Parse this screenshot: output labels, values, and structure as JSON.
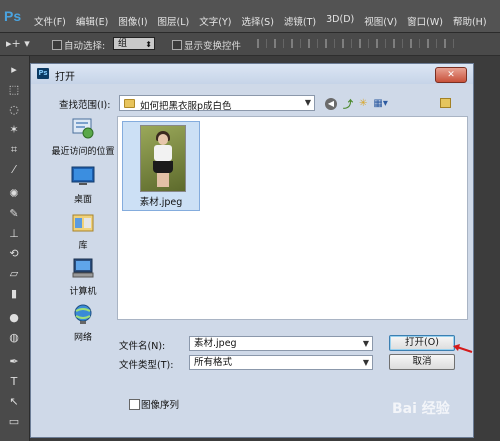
{
  "app": {
    "logo": "Ps"
  },
  "menubar": {
    "items": [
      "文件(F)",
      "编辑(E)",
      "图像(I)",
      "图层(L)",
      "文字(Y)",
      "选择(S)",
      "滤镜(T)",
      "3D(D)",
      "视图(V)",
      "窗口(W)",
      "帮助(H)"
    ]
  },
  "options": {
    "tool_glyph": "▸+ ▾",
    "auto_select_label": "自动选择:",
    "auto_select_value": "组",
    "show_transform_label": "显示变换控件"
  },
  "dialog": {
    "title": "打开",
    "title_icon": "Ps",
    "close_glyph": "✕",
    "lookin_label": "查找范围(I):",
    "lookin_value": "如何把黑衣服p成白色",
    "places": [
      {
        "label": "最近访问的位置",
        "icon": "recent-places-icon"
      },
      {
        "label": "桌面",
        "icon": "desktop-icon"
      },
      {
        "label": "库",
        "icon": "libraries-icon"
      },
      {
        "label": "计算机",
        "icon": "computer-icon"
      },
      {
        "label": "网络",
        "icon": "network-icon"
      }
    ],
    "files": [
      {
        "name": "素材.jpeg"
      }
    ],
    "filename_label": "文件名(N):",
    "filename_value": "素材.jpeg",
    "filetype_label": "文件类型(T):",
    "filetype_value": "所有格式",
    "open_button": "打开(O)",
    "cancel_button": "取消",
    "image_sequence_label": "图像序列"
  },
  "watermark": "Bai 经验"
}
